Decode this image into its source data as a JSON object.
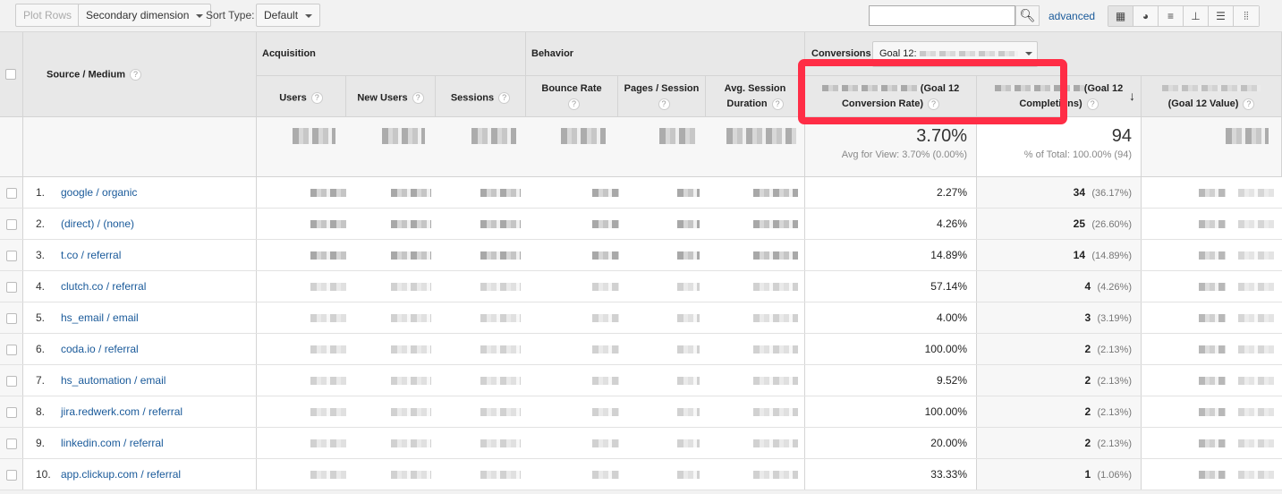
{
  "toolbar": {
    "plot_rows": "Plot Rows",
    "secondary_dimension": "Secondary dimension",
    "sort_type_label": "Sort Type:",
    "sort_type_value": "Default",
    "search_value": "",
    "search_icon": "magnifier",
    "advanced": "advanced",
    "view_icons": [
      "grid-icon",
      "pie-icon",
      "bar-icon",
      "compare-icon",
      "term-cloud-icon",
      "pivot-icon"
    ]
  },
  "header": {
    "source_medium": "Source / Medium",
    "acquisition": "Acquisition",
    "behavior": "Behavior",
    "conversions": "Conversions",
    "goal_select": "Goal 12:",
    "users": "Users",
    "new_users": "New Users",
    "sessions": "Sessions",
    "bounce_rate": "Bounce Rate",
    "pages_session": "Pages / Session",
    "avg_session_duration": "Avg. Session Duration",
    "conv_rate_a": "(Goal 12",
    "conv_rate_b": "Conversion Rate)",
    "completions_a": "(Goal 12",
    "completions_b": "Completions)",
    "value": "(Goal 12 Value)"
  },
  "totals": {
    "conv_rate": "3.70%",
    "conv_rate_sub": "Avg for View: 3.70% (0.00%)",
    "completions": "94",
    "completions_sub": "% of Total: 100.00% (94)"
  },
  "highlight_color": "#ff2d46",
  "rows": [
    {
      "n": "1.",
      "source": "google / organic",
      "rate": "2.27%",
      "comp": "34",
      "pct": "(36.17%)"
    },
    {
      "n": "2.",
      "source": "(direct) / (none)",
      "rate": "4.26%",
      "comp": "25",
      "pct": "(26.60%)"
    },
    {
      "n": "3.",
      "source": "t.co / referral",
      "rate": "14.89%",
      "comp": "14",
      "pct": "(14.89%)"
    },
    {
      "n": "4.",
      "source": "clutch.co / referral",
      "rate": "57.14%",
      "comp": "4",
      "pct": "(4.26%)"
    },
    {
      "n": "5.",
      "source": "hs_email / email",
      "rate": "4.00%",
      "comp": "3",
      "pct": "(3.19%)"
    },
    {
      "n": "6.",
      "source": "coda.io / referral",
      "rate": "100.00%",
      "comp": "2",
      "pct": "(2.13%)"
    },
    {
      "n": "7.",
      "source": "hs_automation / email",
      "rate": "9.52%",
      "comp": "2",
      "pct": "(2.13%)"
    },
    {
      "n": "8.",
      "source": "jira.redwerk.com / referral",
      "rate": "100.00%",
      "comp": "2",
      "pct": "(2.13%)"
    },
    {
      "n": "9.",
      "source": "linkedin.com / referral",
      "rate": "20.00%",
      "comp": "2",
      "pct": "(2.13%)"
    },
    {
      "n": "10.",
      "source": "app.clickup.com / referral",
      "rate": "33.33%",
      "comp": "1",
      "pct": "(1.06%)"
    }
  ]
}
